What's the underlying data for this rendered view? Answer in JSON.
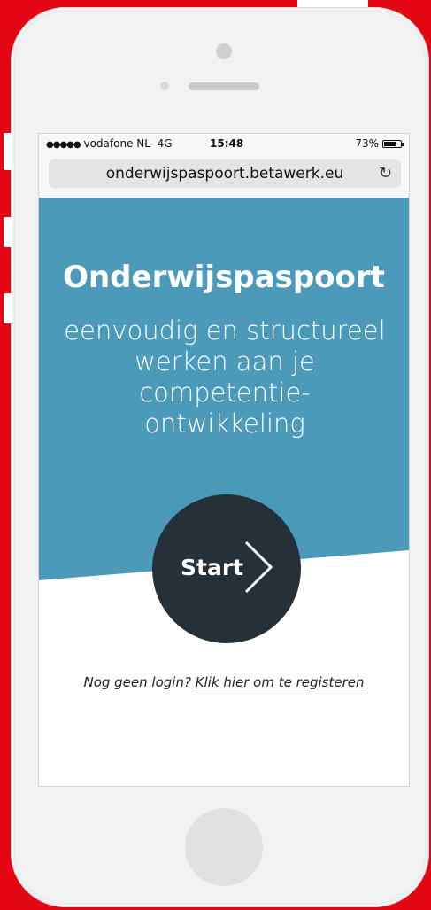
{
  "status": {
    "signal_dots": "●●●●●",
    "carrier": "vodafone NL",
    "network": "4G",
    "time": "15:48",
    "battery": "73%",
    "battery_level": 0.73
  },
  "browser": {
    "url": "onderwijspaspoort.betawerk.eu",
    "reload_icon": "reload-icon"
  },
  "hero": {
    "title": "Onderwijspaspoort",
    "subtitle_lines": [
      "eenvoudig en structureel",
      "werken aan je competentie-",
      "ontwikkeling"
    ]
  },
  "start_button": {
    "label": "Start",
    "icon": "chevron-right-icon"
  },
  "register": {
    "prompt": "Nog geen login?",
    "link": "Klik hier om te registeren"
  },
  "colors": {
    "background": "#e30613",
    "hero": "#4b9ab9",
    "button": "#253039"
  }
}
